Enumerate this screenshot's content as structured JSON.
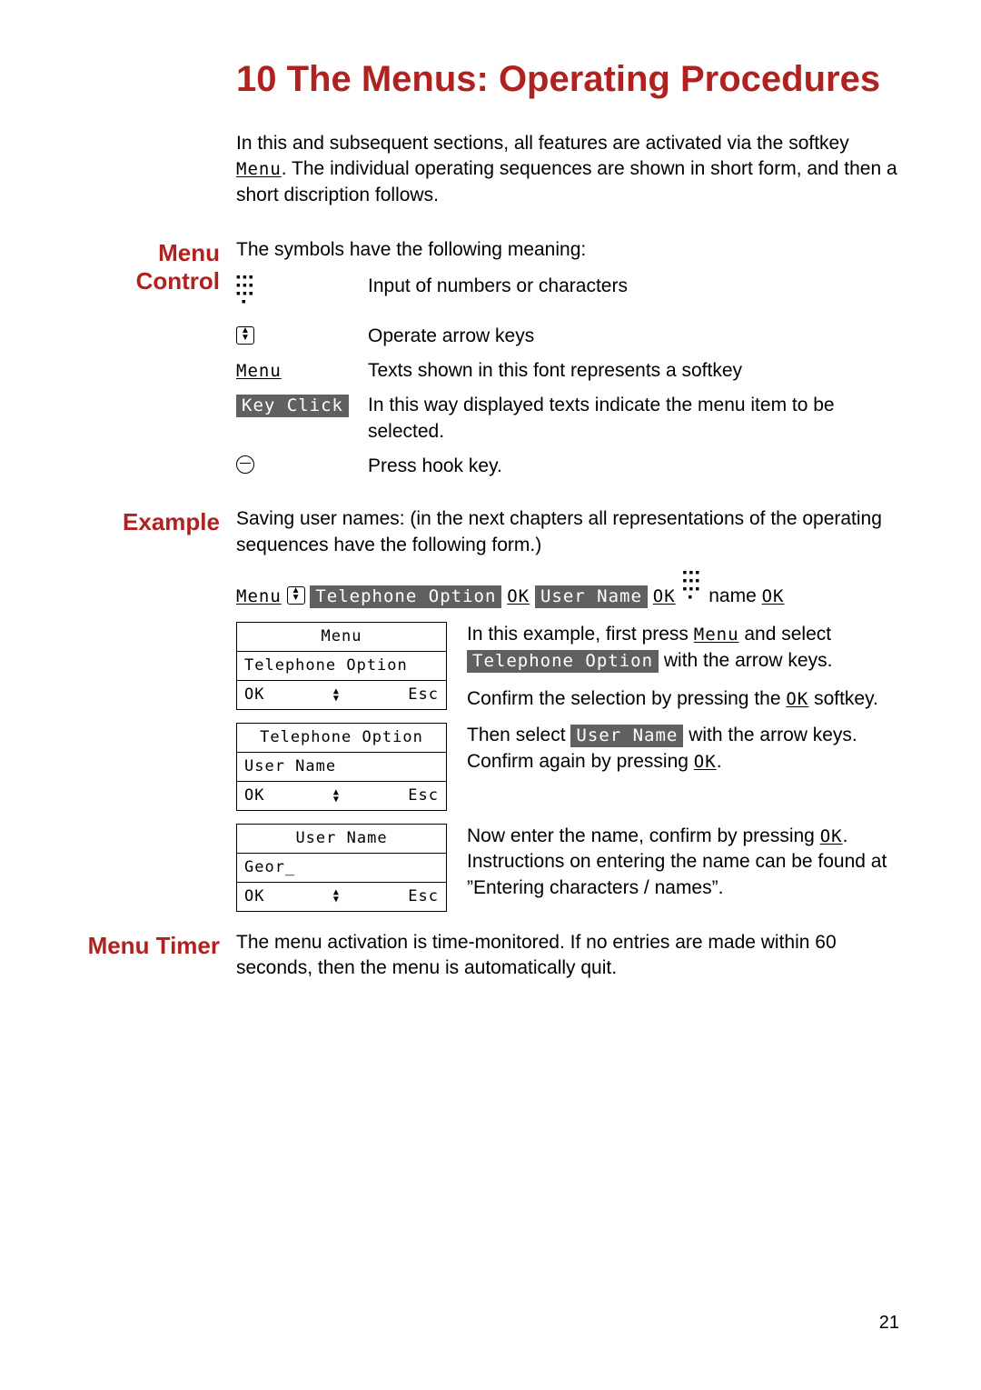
{
  "page_number": "21",
  "title": "10  The Menus: Operating Procedures",
  "intro": {
    "part1": "In this and subsequent sections, all features are activated via the softkey ",
    "softkey": "Menu",
    "part2": ". The individual operating sequences are shown in short form, and then a short discription follows."
  },
  "menu_control": {
    "heading": "Menu Control",
    "lead": "The symbols have the following meaning:",
    "rows": {
      "input": "Input of numbers or characters",
      "arrows": "Operate arrow keys",
      "softkey_label": "Menu",
      "softkey_desc": "Texts shown in this font represents a softkey",
      "menuitem_label": "Key Click",
      "menuitem_desc": "In this way displayed texts indicate the menu item to be selected.",
      "hook": "Press hook key."
    }
  },
  "example": {
    "heading": "Example",
    "lead": "Saving user names: (in the next chapters all representations of the operating sequences have the following form.)",
    "sequence": {
      "sk_menu": "Menu",
      "mi_telopt": "Telephone Option",
      "sk_ok": "OK",
      "mi_username": "User Name",
      "txt_name": " name "
    },
    "screens": [
      {
        "title": "Menu",
        "line": "Telephone Option",
        "ok": "OK",
        "esc": "Esc"
      },
      {
        "title": "Telephone Option",
        "line": "User Name",
        "ok": "OK",
        "esc": "Esc"
      },
      {
        "title": "User Name",
        "line": "Geor_",
        "ok": "OK",
        "esc": "Esc"
      }
    ],
    "desc1": {
      "a": "In this example, first press ",
      "sk_menu": "Menu",
      "b": " and select ",
      "mi_telopt": "Telephone Option",
      "c": " with the arrow keys."
    },
    "desc1b": {
      "a": "Confirm the selection by pressing the ",
      "sk_ok": "OK",
      "b": " softkey."
    },
    "desc2": {
      "a": "Then select ",
      "mi_username": "User Name",
      "b": " with the arrow keys. Confirm again by pressing ",
      "sk_ok": "OK",
      "c": "."
    },
    "desc3": {
      "a": "Now enter the name, confirm by pressing ",
      "sk_ok": "OK",
      "b": ". Instructions on enter­ing the name can be found at ”Entering characters / names”."
    }
  },
  "menu_timer": {
    "heading": "Menu Timer",
    "text": "The menu activation is time-monitored. If no entries are made within 60 seconds, then the menu is automatically quit."
  }
}
